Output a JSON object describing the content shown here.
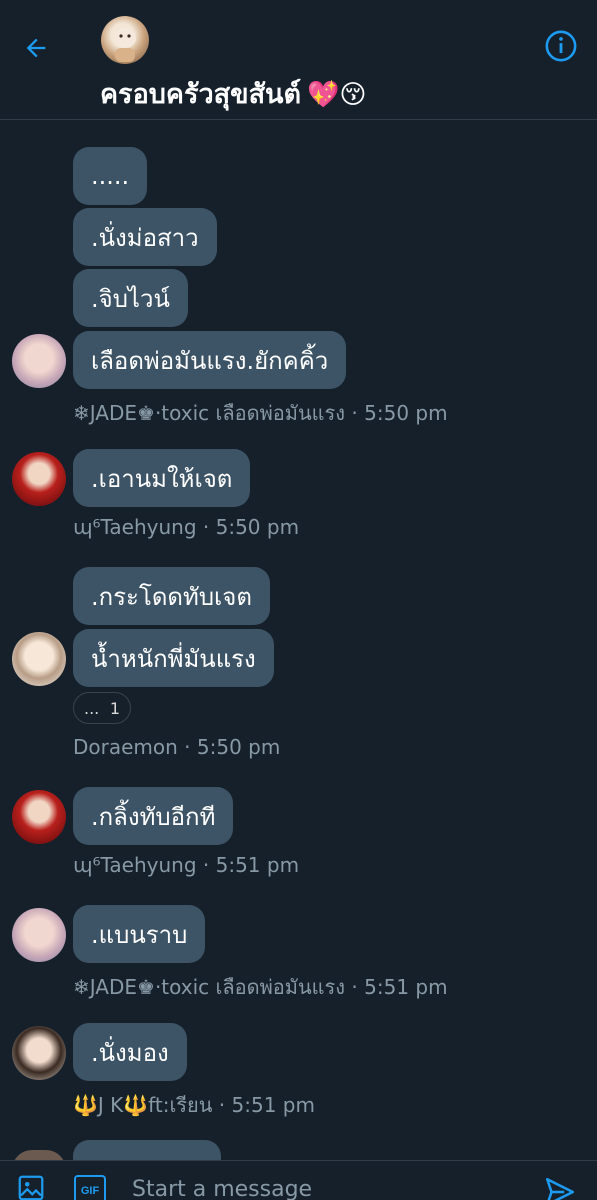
{
  "header": {
    "title": "ครอบครัวสุขสันต์",
    "title_emoji": "💖😚"
  },
  "messages": [
    {
      "text": "....."
    },
    {
      "text": ".นั่งม่อสาว"
    },
    {
      "text": ".จิบไวน์"
    },
    {
      "text": "เลือดพ่อมันแรง.ยักคคิ้ว"
    },
    {
      "text": ".เอานมให้เจต"
    },
    {
      "text": ".กระโดดทับเจต"
    },
    {
      "text": "น้ำหนักพี่มันแรง"
    },
    {
      "text": ".กลิ้งทับอีกที"
    },
    {
      "text": ".แบนราบ"
    },
    {
      "text": ".นั่งมอง"
    }
  ],
  "meta": [
    {
      "sender": "❄JADE♚·toxic เลือดพ่อมันแรง",
      "time": "5:50 pm"
    },
    {
      "sender": "ɰ⁶Taehyung",
      "time": "5:50 pm"
    },
    {
      "sender": "Doraemon",
      "time": "5:50 pm"
    },
    {
      "sender": "ɰ⁶Taehyung",
      "time": "5:51 pm"
    },
    {
      "sender": "❄JADE♚·toxic เลือดพ่อมันแรง",
      "time": "5:51 pm"
    },
    {
      "sender": "🔱J K🔱ft:เรียน",
      "time": "5:51 pm"
    }
  ],
  "meta_separator": " · ",
  "reaction": {
    "icon": "...",
    "count": "1"
  },
  "composer": {
    "placeholder": "Start a message"
  },
  "colors": {
    "background": "#15202b",
    "bubble": "#3d5466",
    "accent": "#1d9bf0",
    "muted": "#8899a6"
  },
  "icons": {
    "back": "arrow-left-icon",
    "info": "info-icon",
    "image": "image-icon",
    "gif": "gif-icon",
    "send": "send-icon"
  }
}
